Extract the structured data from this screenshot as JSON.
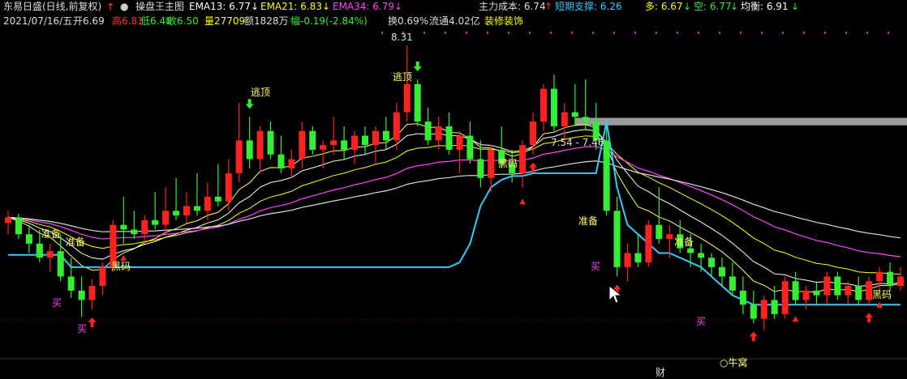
{
  "header": {
    "stock_name": "东易日盛(日线,前复权)",
    "indicator_name": "操盘王主图",
    "ema13": "EMA13: 6.77",
    "ema21": "EMA21: 6.83",
    "ema34": "EMA34: 6.79",
    "main_cost": "主力成本: 6.74",
    "short_support": "短期支撑: 6.26",
    "long": "多: 6.67",
    "short": "空: 6.77",
    "balance": "均衡: 6.91",
    "arrow_down": "↓",
    "arrow_up": "↑",
    "colors": {
      "ema13": "#ffffff",
      "ema21": "#ffff00",
      "ema34": "#ff44ff",
      "support": "#33ccff",
      "up": "#ff2020",
      "down": "#33ee33",
      "label": "#ffff66"
    }
  },
  "quote": {
    "date": "2021/07/16/五",
    "open": "开6.69",
    "high": "高6.81",
    "low": "低6.48",
    "close": "收6.50",
    "volume": "量27709",
    "amount": "额1828万",
    "change": "幅-0.19(-2.84%)",
    "turnover": "换0.69%",
    "float": "流通4.02亿",
    "sector": "装修装饰"
  },
  "chart_data": {
    "type": "candlestick",
    "max_price_label": "8.31",
    "range_label": "7.54 - 7.46",
    "annotations": {
      "escape_top": "逃顶",
      "prepare": "准备",
      "black_code": "黑码",
      "buy": "买",
      "cai": "财",
      "niu_wo": "○牛窝"
    },
    "ylim": [
      5.0,
      8.45
    ],
    "candles": [
      [
        6.42,
        6.55,
        6.3,
        6.48
      ],
      [
        6.48,
        6.52,
        6.25,
        6.3
      ],
      [
        6.3,
        6.4,
        6.1,
        6.2
      ],
      [
        6.2,
        6.35,
        6.0,
        6.05
      ],
      [
        6.05,
        6.2,
        5.9,
        6.12
      ],
      [
        6.12,
        6.3,
        5.8,
        5.85
      ],
      [
        5.85,
        6.05,
        5.62,
        5.7
      ],
      [
        5.7,
        5.85,
        5.42,
        5.6
      ],
      [
        5.6,
        5.82,
        5.5,
        5.75
      ],
      [
        5.75,
        6.0,
        5.65,
        5.95
      ],
      [
        5.95,
        6.45,
        5.9,
        6.4
      ],
      [
        6.4,
        6.7,
        6.2,
        6.35
      ],
      [
        6.35,
        6.55,
        6.25,
        6.3
      ],
      [
        6.3,
        6.5,
        6.2,
        6.45
      ],
      [
        6.45,
        6.75,
        6.35,
        6.4
      ],
      [
        6.4,
        6.8,
        6.3,
        6.55
      ],
      [
        6.55,
        6.9,
        6.45,
        6.5
      ],
      [
        6.5,
        6.75,
        6.42,
        6.6
      ],
      [
        6.6,
        6.95,
        6.5,
        6.55
      ],
      [
        6.55,
        6.85,
        6.45,
        6.7
      ],
      [
        6.7,
        7.05,
        6.6,
        6.65
      ],
      [
        6.65,
        7.1,
        6.55,
        6.95
      ],
      [
        6.95,
        7.7,
        6.85,
        7.3
      ],
      [
        7.3,
        7.55,
        7.0,
        7.1
      ],
      [
        7.1,
        7.45,
        6.95,
        7.4
      ],
      [
        7.4,
        7.5,
        7.1,
        7.15
      ],
      [
        7.15,
        7.35,
        6.95,
        7.0
      ],
      [
        7.0,
        7.2,
        6.9,
        7.1
      ],
      [
        7.1,
        7.5,
        7.0,
        7.4
      ],
      [
        7.4,
        7.45,
        7.15,
        7.2
      ],
      [
        7.2,
        7.3,
        7.0,
        7.25
      ],
      [
        7.25,
        7.55,
        7.15,
        7.3
      ],
      [
        7.3,
        7.45,
        7.1,
        7.2
      ],
      [
        7.2,
        7.4,
        7.05,
        7.35
      ],
      [
        7.35,
        7.45,
        7.15,
        7.25
      ],
      [
        7.25,
        7.45,
        7.05,
        7.4
      ],
      [
        7.4,
        7.55,
        7.2,
        7.3
      ],
      [
        7.3,
        7.7,
        7.2,
        7.6
      ],
      [
        7.6,
        8.31,
        7.5,
        7.9
      ],
      [
        7.9,
        7.95,
        7.45,
        7.5
      ],
      [
        7.5,
        7.65,
        7.25,
        7.3
      ],
      [
        7.3,
        7.55,
        7.2,
        7.45
      ],
      [
        7.45,
        7.6,
        7.15,
        7.2
      ],
      [
        7.2,
        7.4,
        6.95,
        7.35
      ],
      [
        7.35,
        7.5,
        7.05,
        7.1
      ],
      [
        7.1,
        7.3,
        6.8,
        6.9
      ],
      [
        6.9,
        7.25,
        6.75,
        7.2
      ],
      [
        7.2,
        7.45,
        7.0,
        7.05
      ],
      [
        7.05,
        7.2,
        6.85,
        6.95
      ],
      [
        6.95,
        7.3,
        6.8,
        7.25
      ],
      [
        7.25,
        7.6,
        7.15,
        7.5
      ],
      [
        7.5,
        7.9,
        7.4,
        7.85
      ],
      [
        7.85,
        8.0,
        7.4,
        7.45
      ],
      [
        7.45,
        7.7,
        7.3,
        7.6
      ],
      [
        7.6,
        7.9,
        7.45,
        7.55
      ],
      [
        7.55,
        7.95,
        7.4,
        7.5
      ],
      [
        7.5,
        7.7,
        7.2,
        7.3
      ],
      [
        7.3,
        7.45,
        6.5,
        6.55
      ],
      [
        6.55,
        6.7,
        5.85,
        5.95
      ],
      [
        5.95,
        6.2,
        5.8,
        6.1
      ],
      [
        6.1,
        6.3,
        5.95,
        6.0
      ],
      [
        6.0,
        6.45,
        5.95,
        6.4
      ],
      [
        6.4,
        6.8,
        6.2,
        6.25
      ],
      [
        6.25,
        6.4,
        6.05,
        6.3
      ],
      [
        6.3,
        6.45,
        6.1,
        6.15
      ],
      [
        6.15,
        6.3,
        5.95,
        6.1
      ],
      [
        6.1,
        6.2,
        5.9,
        6.05
      ],
      [
        6.05,
        6.1,
        5.85,
        5.95
      ],
      [
        5.95,
        6.05,
        5.75,
        5.85
      ],
      [
        5.85,
        6.0,
        5.65,
        5.7
      ],
      [
        5.7,
        5.85,
        5.45,
        5.55
      ],
      [
        5.55,
        5.7,
        5.35,
        5.4
      ],
      [
        5.4,
        5.65,
        5.28,
        5.6
      ],
      [
        5.6,
        5.75,
        5.4,
        5.45
      ],
      [
        5.45,
        5.85,
        5.4,
        5.8
      ],
      [
        5.8,
        5.9,
        5.55,
        5.6
      ],
      [
        5.6,
        5.75,
        5.5,
        5.7
      ],
      [
        5.7,
        5.8,
        5.55,
        5.65
      ],
      [
        5.65,
        5.9,
        5.55,
        5.85
      ],
      [
        5.85,
        5.9,
        5.6,
        5.65
      ],
      [
        5.65,
        5.8,
        5.55,
        5.75
      ],
      [
        5.75,
        5.85,
        5.55,
        5.6
      ],
      [
        5.6,
        5.85,
        5.55,
        5.8
      ],
      [
        5.8,
        5.95,
        5.7,
        5.9
      ],
      [
        5.9,
        6.0,
        5.7,
        5.75
      ],
      [
        5.75,
        5.95,
        5.7,
        5.85
      ]
    ],
    "support_line": [
      6.08,
      6.08,
      6.08,
      6.08,
      6.08,
      6.08,
      5.95,
      5.95,
      5.95,
      5.95,
      5.95,
      5.95,
      5.95,
      5.95,
      5.95,
      5.95,
      5.95,
      5.95,
      5.95,
      5.95,
      5.95,
      5.95,
      5.95,
      5.95,
      5.95,
      5.95,
      5.95,
      5.95,
      5.95,
      5.95,
      5.95,
      5.95,
      5.95,
      5.95,
      5.95,
      5.95,
      5.95,
      5.95,
      5.95,
      5.95,
      5.95,
      5.95,
      5.95,
      6.0,
      6.2,
      6.6,
      6.8,
      6.88,
      6.92,
      6.92,
      6.95,
      6.95,
      6.95,
      6.95,
      6.95,
      6.95,
      6.95,
      7.5,
      6.8,
      6.4,
      6.3,
      6.2,
      6.1,
      6.1,
      6.05,
      6.0,
      5.95,
      5.85,
      5.75,
      5.65,
      5.6,
      5.55,
      5.55,
      5.55,
      5.55,
      5.55,
      5.55,
      5.55,
      5.55,
      5.55,
      5.55,
      5.55,
      5.55,
      5.55,
      5.55,
      5.55
    ],
    "markers": {
      "red_up_arrows": [
        8,
        50,
        58,
        71,
        82
      ],
      "green_down_arrows": [
        23,
        39
      ],
      "red_triangles": [
        11,
        49,
        75,
        83
      ]
    }
  }
}
